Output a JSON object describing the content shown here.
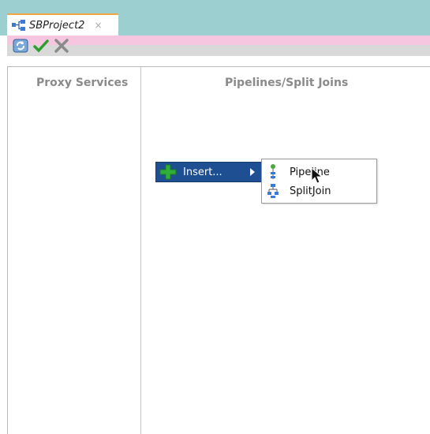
{
  "tab": {
    "title": "SBProject2",
    "close": "×",
    "icon": "project-icon"
  },
  "toolbar": {
    "icons": [
      "refresh-icon",
      "check-icon",
      "cancel-icon"
    ]
  },
  "panels": {
    "left_title": "Proxy Services",
    "right_title": "Pipelines/Split Joins"
  },
  "context_menu": {
    "insert_label": "Insert...",
    "icon": "plus-icon"
  },
  "submenu": {
    "items": [
      {
        "label": "Pipeline",
        "icon": "pipeline-icon"
      },
      {
        "label": "SplitJoin",
        "icon": "splitjoin-icon"
      }
    ]
  },
  "colors": {
    "titlebar": "#9ccfcf",
    "menu_highlight": "#1f4f93",
    "accent_tab": "#f0a63c"
  }
}
